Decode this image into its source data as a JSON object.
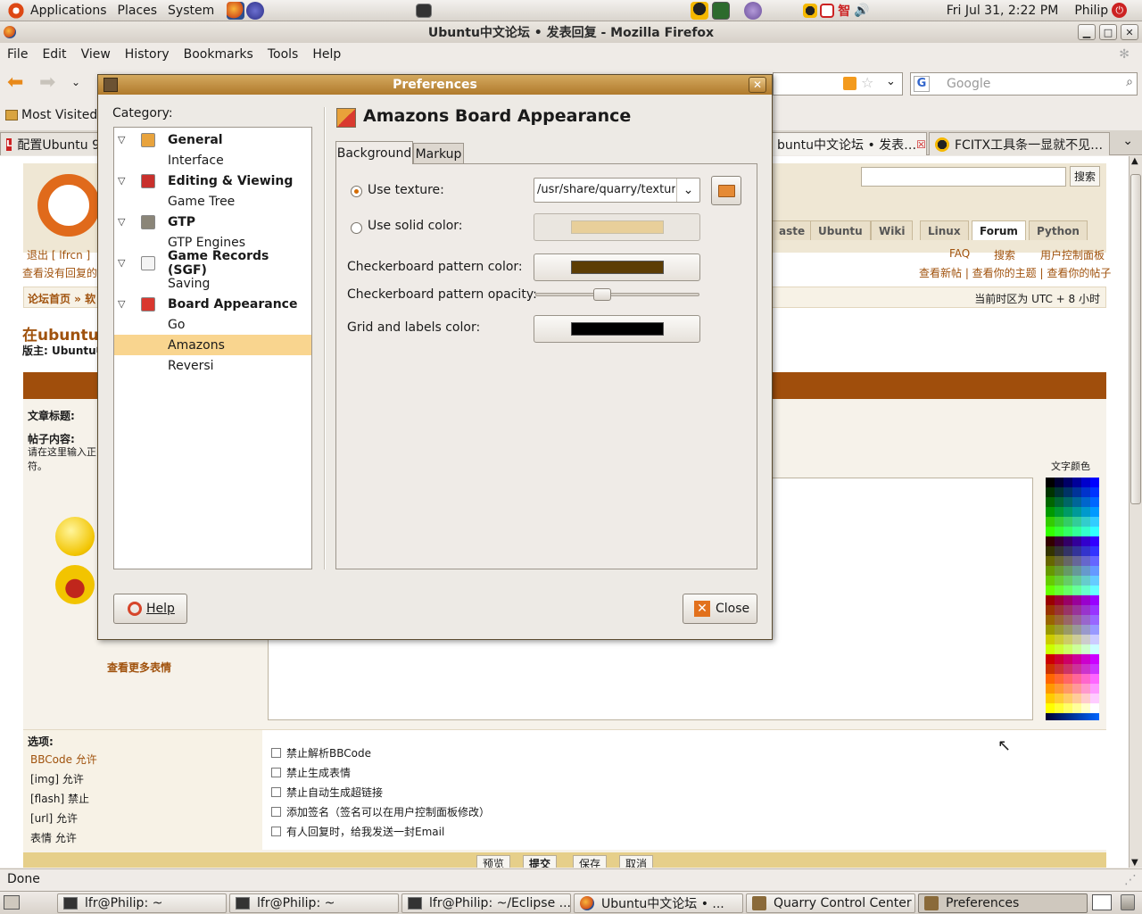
{
  "top_panel": {
    "menus": [
      "Applications",
      "Places",
      "System"
    ],
    "clock": "Fri Jul 31,  2:22 PM",
    "user": "Philip"
  },
  "firefox": {
    "title": "Ubuntu中文论坛 • 发表回复 - Mozilla Firefox",
    "menu": [
      "File",
      "Edit",
      "View",
      "History",
      "Bookmarks",
      "Tools",
      "Help"
    ],
    "search_placeholder": "Google",
    "bookmark_most_visited": "Most Visited",
    "tabs": [
      "配置Ubuntu 9",
      "buntu中文论坛 • 发表…",
      "FCITX工具条一显就不见…"
    ],
    "status": "Done"
  },
  "forum": {
    "search_button": "搜索",
    "nav_tabs": [
      "aste",
      "Ubuntu",
      "Wiki",
      "Linux",
      "Forum",
      "Python"
    ],
    "logout": "退出 [ lfrcn ]",
    "no_reply": "查看没有回复的",
    "faq": "FAQ",
    "search_link": "搜索",
    "user_cp": "用户控制面板",
    "view_links": "查看新帖 | 查看你的主题 | 查看你的帖子",
    "breadcrumb": "论坛首页 » 软",
    "timezone": "当前时区为 UTC + 8 小时",
    "page_heading": "在ubuntu",
    "moderator": "版主: Ubuntu中",
    "subject_label": "文章标题:",
    "body_label": "帖子内容:",
    "body_hint": "请在这里输入正\n符。",
    "more_smilies": "查看更多表情",
    "text_color": "文字颜色",
    "options_title": "选项:",
    "option_lines": [
      "BBCode 允许",
      "[img] 允许",
      "[flash] 禁止",
      "[url] 允许",
      "表情 允许"
    ],
    "checkboxes": [
      "禁止解析BBCode",
      "禁止生成表情",
      "禁止自动生成超链接",
      "添加签名（签名可以在用户控制面板修改）",
      "有人回复时，给我发送一封Email"
    ],
    "buttons": [
      "预览",
      "提交",
      "保存",
      "取消"
    ]
  },
  "dialog": {
    "title": "Preferences",
    "category_label": "Category:",
    "tree": [
      {
        "label": "General",
        "bold": true,
        "icon_color": "#e8a33d"
      },
      {
        "label": "Interface",
        "bold": false
      },
      {
        "label": "Editing & Viewing",
        "bold": true,
        "icon_color": "#c8302c"
      },
      {
        "label": "Game Tree",
        "bold": false
      },
      {
        "label": "GTP",
        "bold": true,
        "icon_color": "#8a8578"
      },
      {
        "label": "GTP Engines",
        "bold": false
      },
      {
        "label": "Game Records (SGF)",
        "bold": true,
        "icon_color": "#f4f4f4"
      },
      {
        "label": "Saving",
        "bold": false
      },
      {
        "label": "Board Appearance",
        "bold": true,
        "icon_color": "#d9382f"
      },
      {
        "label": "Go",
        "bold": false
      },
      {
        "label": "Amazons",
        "bold": false,
        "selected": true
      },
      {
        "label": "Reversi",
        "bold": false
      }
    ],
    "heading": "Amazons Board Appearance",
    "tabs": [
      "Background",
      "Markup"
    ],
    "use_texture": "Use texture:",
    "texture_path": "/usr/share/quarry/textur",
    "use_solid_color": "Use solid color:",
    "solid_color": "#e8cf9a",
    "checker_color_label": "Checkerboard pattern color:",
    "checker_color": "#5c3d04",
    "checker_opacity_label": "Checkerboard pattern opacity:",
    "checker_opacity_value": 0.38,
    "grid_color_label": "Grid and labels color:",
    "grid_color": "#000000",
    "help_button": "Help",
    "close_button": "Close"
  },
  "taskbar": [
    {
      "label": "lfr@Philip: ~"
    },
    {
      "label": "lfr@Philip: ~"
    },
    {
      "label": "lfr@Philip: ~/Eclipse ..."
    },
    {
      "label": "Ubuntu中文论坛 • ..."
    },
    {
      "label": "Quarry Control Center"
    },
    {
      "label": "Preferences",
      "active": true
    }
  ]
}
